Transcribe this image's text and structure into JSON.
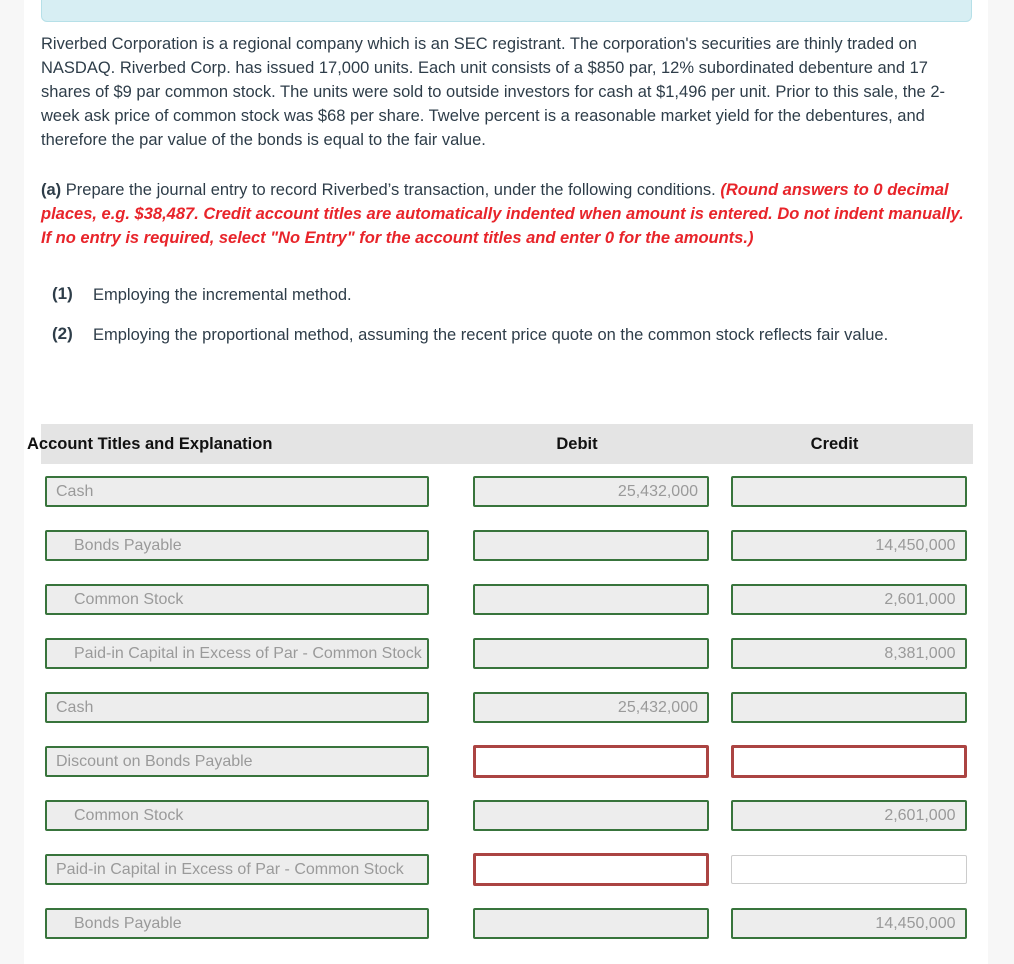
{
  "banner": {
    "name": "info-banner"
  },
  "problem": {
    "paragraph": "Riverbed Corporation is a regional company which is an SEC registrant. The corporation's securities are thinly traded on NASDAQ. Riverbed Corp. has issued 17,000 units. Each unit consists of a $850 par, 12% subordinated debenture and 17 shares of $9 par common stock. The units were sold to outside investors for cash at $1,496 per unit. Prior to this sale, the 2-week ask price of common stock was $68 per share. Twelve percent is a reasonable market yield for the debentures, and therefore the par value of the bonds is equal to the fair value.",
    "question_label": "(a)",
    "question_text": "Prepare the journal entry to record Riverbed’s transaction, under the following conditions.",
    "red_instruction": "(Round answers to 0 decimal places, e.g. $38,487. Credit account titles are automatically indented when amount is entered. Do not indent manually. If no entry is required, select \"No Entry\" for the account titles and enter 0 for the amounts.)",
    "sub_items": [
      {
        "number": "(1)",
        "text": "Employing the incremental method."
      },
      {
        "number": "(2)",
        "text": "Employing the proportional method, assuming the recent price quote on the common stock reflects fair value."
      }
    ]
  },
  "journal": {
    "columns": {
      "account": "Account Titles and Explanation",
      "debit": "Debit",
      "credit": "Credit"
    },
    "rows": [
      {
        "account": {
          "value": "Cash",
          "indent": false,
          "state": "filled"
        },
        "debit": {
          "value": "25,432,000",
          "state": "filled"
        },
        "credit": {
          "value": "",
          "state": "filled"
        }
      },
      {
        "account": {
          "value": "Bonds Payable",
          "indent": true,
          "state": "filled"
        },
        "debit": {
          "value": "",
          "state": "filled"
        },
        "credit": {
          "value": "14,450,000",
          "state": "filled"
        }
      },
      {
        "account": {
          "value": "Common Stock",
          "indent": true,
          "state": "filled"
        },
        "debit": {
          "value": "",
          "state": "filled"
        },
        "credit": {
          "value": "2,601,000",
          "state": "filled"
        }
      },
      {
        "account": {
          "value": "Paid-in Capital in Excess of Par - Common Stock",
          "indent": true,
          "state": "filled"
        },
        "debit": {
          "value": "",
          "state": "filled"
        },
        "credit": {
          "value": "8,381,000",
          "state": "filled"
        }
      },
      {
        "account": {
          "value": "Cash",
          "indent": false,
          "state": "filled"
        },
        "debit": {
          "value": "25,432,000",
          "state": "filled"
        },
        "credit": {
          "value": "",
          "state": "filled"
        }
      },
      {
        "account": {
          "value": "Discount on Bonds Payable",
          "indent": false,
          "state": "filled"
        },
        "debit": {
          "value": "",
          "state": "error"
        },
        "credit": {
          "value": "",
          "state": "error"
        }
      },
      {
        "account": {
          "value": "Common Stock",
          "indent": true,
          "state": "filled"
        },
        "debit": {
          "value": "",
          "state": "filled"
        },
        "credit": {
          "value": "2,601,000",
          "state": "filled"
        }
      },
      {
        "account": {
          "value": "Paid-in Capital in Excess of Par - Common Stock",
          "indent": false,
          "state": "filled"
        },
        "debit": {
          "value": "",
          "state": "error"
        },
        "credit": {
          "value": "",
          "state": "plain"
        }
      },
      {
        "account": {
          "value": "Bonds Payable",
          "indent": true,
          "state": "filled"
        },
        "debit": {
          "value": "",
          "state": "filled"
        },
        "credit": {
          "value": "14,450,000",
          "state": "filled"
        }
      }
    ]
  },
  "colors": {
    "valid_border": "#38743c",
    "error_border": "#ab4442",
    "plain_border": "#cccccc",
    "field_bg": "#ededed",
    "header_bg": "#e4e4e4",
    "instruction_red": "#e8242a",
    "banner_bg": "#d7eef3",
    "text": "#2e3d49"
  }
}
